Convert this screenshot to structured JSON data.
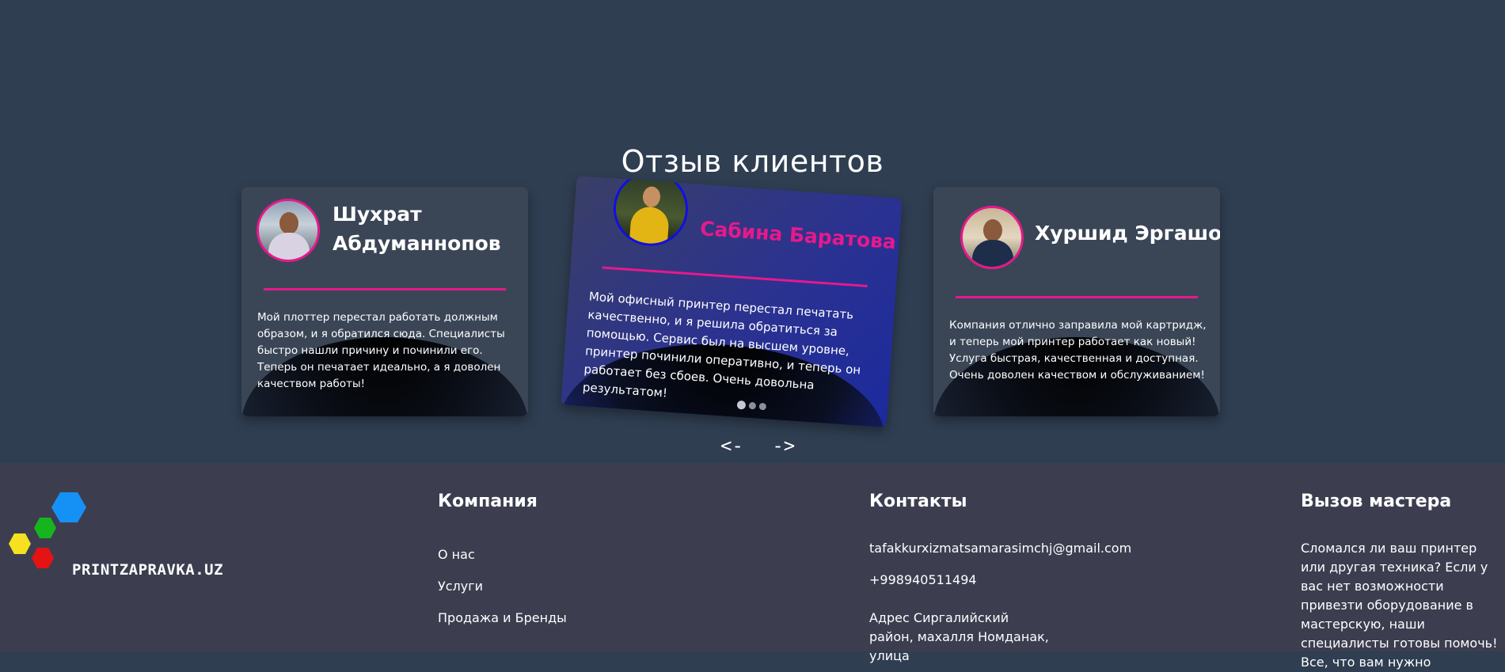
{
  "section": {
    "title": "Отзыв клиентов"
  },
  "testimonials": [
    {
      "name": "Шухрат Абдуманнопов",
      "text": "Мой плоттер перестал работать должным образом, и я обратился сюда. Специалисты быстро нашли причину и починили его. Теперь он печатает идеально, а я доволен качеством работы!"
    },
    {
      "name": "Сабина Баратова",
      "text": "Мой офисный принтер перестал печатать качественно, и я решила обратиться за помощью. Сервис был на высшем уровне, принтер починили оперативно, и теперь он работает без сбоев. Очень довольна результатом!"
    },
    {
      "name": "Хуршид Эргашов",
      "text": "Компания отлично заправила мой картридж, и теперь мой принтер работает как новый! Услуга быстрая, качественная и доступная. Очень доволен качеством и обслуживанием!"
    }
  ],
  "slider": {
    "prev": "<-",
    "next": "->"
  },
  "footer": {
    "logo_text": "PRINTZAPRAVKA.UZ",
    "company": {
      "title": "Компания",
      "links": [
        "О нас",
        "Услуги",
        "Продажа и Бренды"
      ]
    },
    "contacts": {
      "title": "Контакты",
      "email": "tafakkurxizmatsamarasimchj@gmail.com",
      "phone": "+998940511494",
      "address": "Адрес Сиргалийский район, махалля Номданак, улица"
    },
    "call_master": {
      "title": "Вызов мастера",
      "text": "Сломался ли ваш принтер или другая техника? Если у вас нет возможности привезти оборудование в мастерскую, наши специалисты готовы помочь! Все, что вам нужно"
    }
  },
  "colors": {
    "accent": "#e6198c",
    "background": "#2f3e51",
    "footer": "#3c3e50"
  }
}
